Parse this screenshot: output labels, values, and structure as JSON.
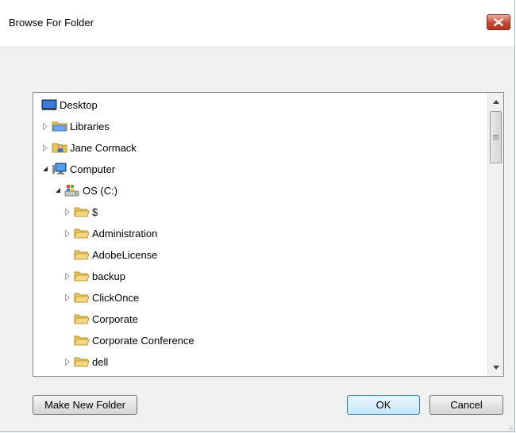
{
  "window": {
    "title": "Browse For Folder",
    "close_label": "X"
  },
  "tree": {
    "items": [
      {
        "label": "Desktop",
        "icon": "desktop-icon",
        "expander": "none",
        "level": 0
      },
      {
        "label": "Libraries",
        "icon": "libraries-icon",
        "expander": "collapsed",
        "level": 0
      },
      {
        "label": "Jane Cormack",
        "icon": "user-folder-icon",
        "expander": "collapsed",
        "level": 0
      },
      {
        "label": "Computer",
        "icon": "computer-icon",
        "expander": "expanded",
        "level": 0
      },
      {
        "label": "OS (C:)",
        "icon": "drive-icon",
        "expander": "expanded",
        "level": 1
      },
      {
        "label": "$",
        "icon": "folder-icon",
        "expander": "collapsed",
        "level": 2
      },
      {
        "label": "Administration",
        "icon": "folder-icon",
        "expander": "collapsed",
        "level": 2
      },
      {
        "label": "AdobeLicense",
        "icon": "folder-icon",
        "expander": "none",
        "level": 2
      },
      {
        "label": "backup",
        "icon": "folder-icon",
        "expander": "collapsed",
        "level": 2
      },
      {
        "label": "ClickOnce",
        "icon": "folder-icon",
        "expander": "collapsed",
        "level": 2
      },
      {
        "label": "Corporate",
        "icon": "folder-icon",
        "expander": "none",
        "level": 2
      },
      {
        "label": "Corporate Conference",
        "icon": "folder-icon",
        "expander": "none",
        "level": 2
      },
      {
        "label": "dell",
        "icon": "folder-icon",
        "expander": "collapsed",
        "level": 2
      }
    ]
  },
  "buttons": {
    "make_new_folder": "Make New Folder",
    "ok": "OK",
    "cancel": "Cancel"
  },
  "colors": {
    "folder": "#e8c55a",
    "close_button": "#c74a36",
    "default_button_border": "#3c7fb1"
  }
}
